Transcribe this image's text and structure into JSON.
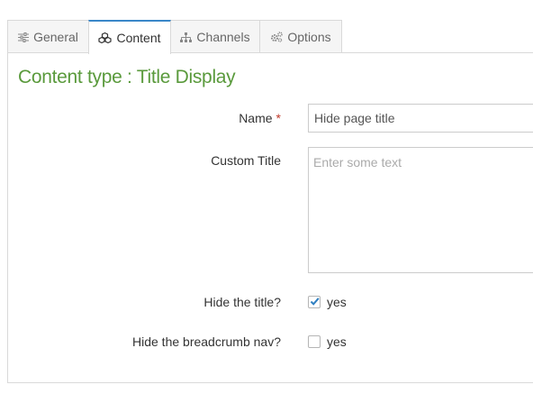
{
  "tabs": [
    {
      "label": "General",
      "icon": "sliders-icon"
    },
    {
      "label": "Content",
      "icon": "cubes-icon"
    },
    {
      "label": "Channels",
      "icon": "sitemap-icon"
    },
    {
      "label": "Options",
      "icon": "cogs-icon"
    }
  ],
  "active_tab": "Content",
  "heading": "Content type : Title Display",
  "form": {
    "name": {
      "label": "Name",
      "required_mark": "*",
      "value": "Hide page title"
    },
    "custom_title": {
      "label": "Custom Title",
      "placeholder": "Enter some text",
      "value": ""
    },
    "hide_title": {
      "label": "Hide the title?",
      "option_label": "yes",
      "checked": true
    },
    "hide_breadcrumb": {
      "label": "Hide the breadcrumb nav?",
      "option_label": "yes",
      "checked": false
    }
  },
  "colors": {
    "heading": "#5a9a3c",
    "active_tab_border": "#3a87c8",
    "required": "#c0392b",
    "check": "#2f7fc1"
  }
}
